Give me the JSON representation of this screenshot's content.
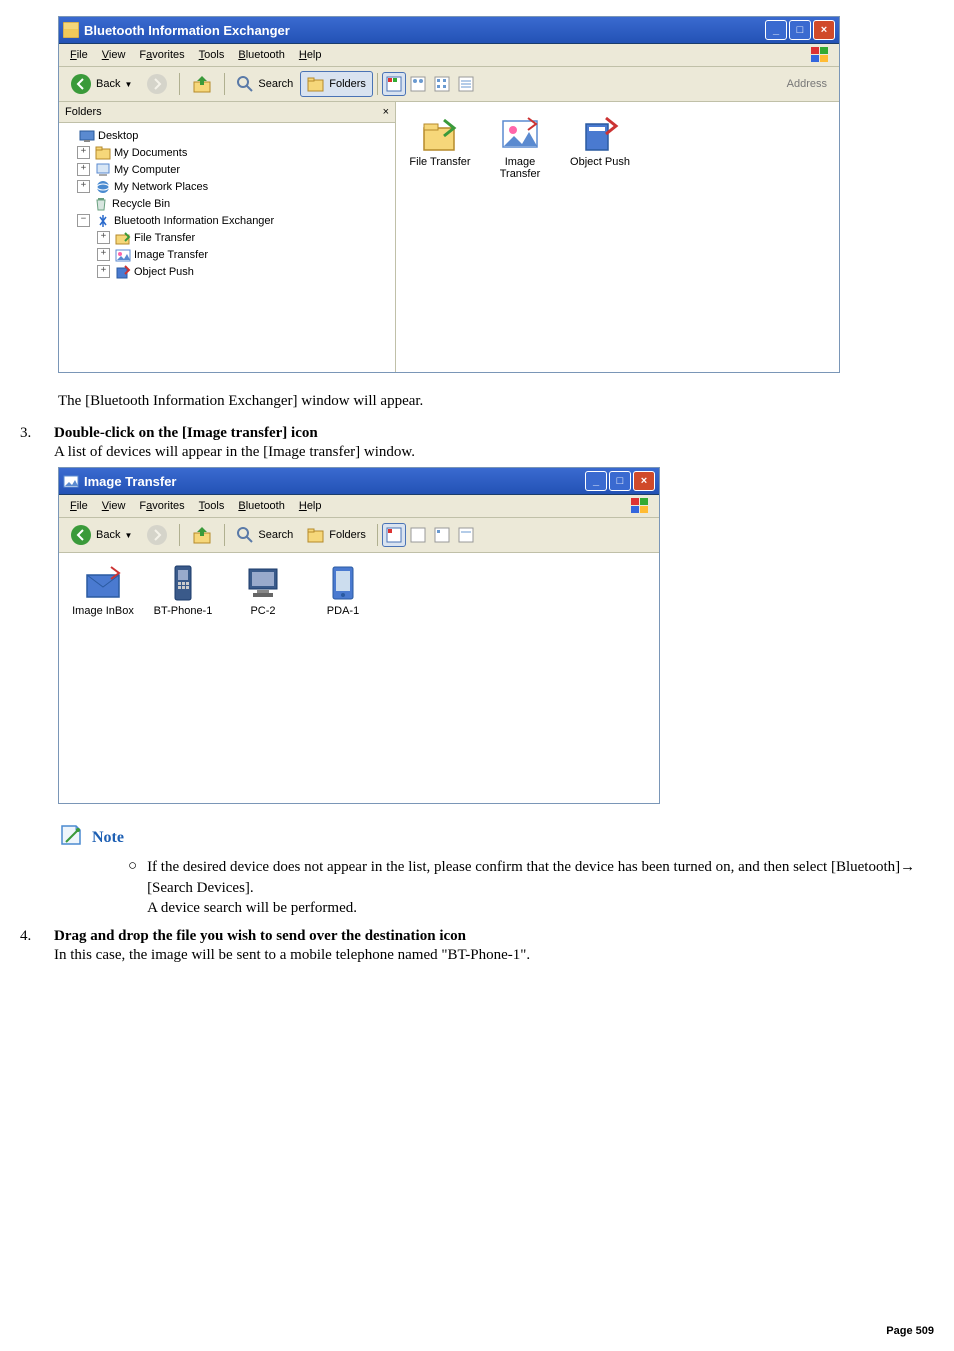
{
  "win1": {
    "title": "Bluetooth Information Exchanger",
    "menus": {
      "file": "File",
      "view": "View",
      "fav": "Favorites",
      "tools": "Tools",
      "bt": "Bluetooth",
      "help": "Help"
    },
    "tb": {
      "back": "Back",
      "search": "Search",
      "folders": "Folders",
      "address": "Address"
    },
    "folders_title": "Folders",
    "tree": {
      "desktop": "Desktop",
      "mydocs": "My Documents",
      "mycomp": "My Computer",
      "mynet": "My Network Places",
      "recycle": "Recycle Bin",
      "btix": "Bluetooth Information Exchanger",
      "ftrans": "File Transfer",
      "itrans": "Image Transfer",
      "opush": "Object Push"
    },
    "icons": {
      "ft": "File Transfer",
      "it": "Image\nTransfer",
      "op": "Object Push"
    }
  },
  "para1": "The [Bluetooth Information Exchanger] window will appear.",
  "step3_num": "3.",
  "step3_title": "Double-click on the [Image transfer] icon",
  "step3_sub": "A list of devices will appear in the [Image transfer] window.",
  "win2": {
    "title": "Image Transfer",
    "menus": {
      "file": "File",
      "view": "View",
      "fav": "Favorites",
      "tools": "Tools",
      "bt": "Bluetooth",
      "help": "Help"
    },
    "tb": {
      "back": "Back",
      "search": "Search",
      "folders": "Folders"
    },
    "icons": {
      "inbox": "Image InBox",
      "p1": "BT-Phone-1",
      "pc2": "PC-2",
      "pda": "PDA-1"
    }
  },
  "note_label": "Note",
  "note_body": "If the desired device does not appear in the list, please confirm that the device has been turned on, and then select [Bluetooth]→ [Search Devices].",
  "note_body2": "A device search will be performed.",
  "step4_num": "4.",
  "step4_title": "Drag and drop the file you wish to send over the destination icon",
  "step4_sub": "In this case, the image will be sent to a mobile telephone named \"BT-Phone-1\".",
  "page_label": "Page  509"
}
